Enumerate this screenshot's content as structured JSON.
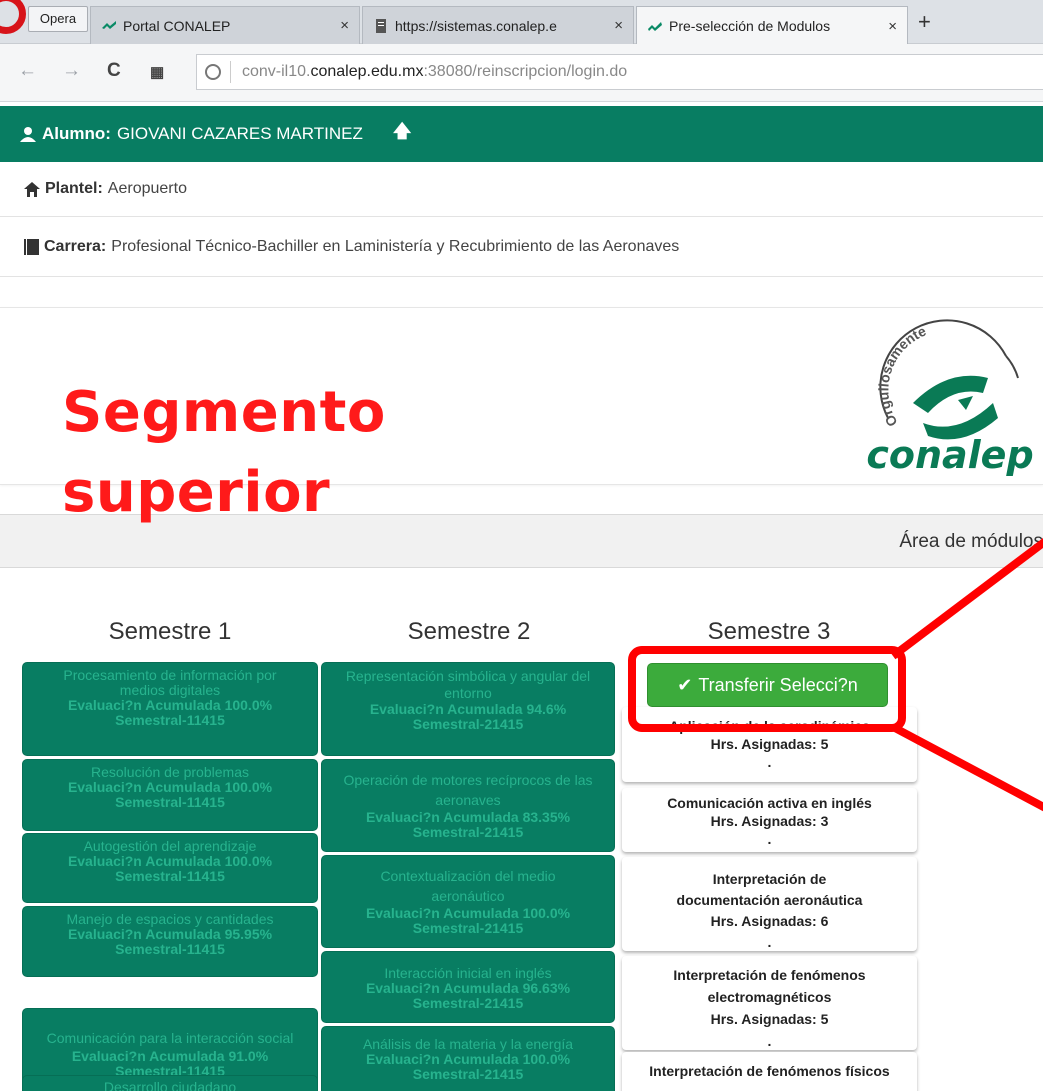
{
  "browser": {
    "menu_label": "Opera",
    "tabs": [
      {
        "title": "Portal CONALEP",
        "close": "×"
      },
      {
        "title": "https://sistemas.conalep.e",
        "close": "×"
      },
      {
        "title": "Pre-selección de Modulos",
        "close": "×"
      }
    ],
    "new_tab": "+",
    "url_prefix": "conv-il10.",
    "url_domain": "conalep.edu.mx",
    "url_suffix": ":38080/reinscripcion/login.do"
  },
  "student": {
    "label": "Alumno:",
    "name": "GIOVANI CAZARES MARTINEZ",
    "arrow": "🡅"
  },
  "plantel": {
    "label": "Plantel:",
    "value": "Aeropuerto"
  },
  "carrera": {
    "label": "Carrera:",
    "value": "Profesional Técnico-Bachiller en Laministería y Recubrimiento de las Aeronaves"
  },
  "annotation": {
    "line1": "Segmento",
    "line2": "superior"
  },
  "logo": {
    "arc_text": "Orgullosamente",
    "brand": "conalep"
  },
  "area_title": "Área de módulos",
  "semesters": [
    {
      "title": "Semestre 1"
    },
    {
      "title": "Semestre 2"
    },
    {
      "title": "Semestre 3"
    }
  ],
  "semester1_modules": [
    {
      "name": "Procesamiento de información por medios digitales",
      "eval": "Evaluaci?n Acumulada 100.0%",
      "sem": "Semestral-11415"
    },
    {
      "name": "Resolución de problemas",
      "eval": "Evaluaci?n Acumulada 100.0%",
      "sem": "Semestral-11415"
    },
    {
      "name": "Autogestión del aprendizaje",
      "eval": "Evaluaci?n Acumulada 100.0%",
      "sem": "Semestral-11415"
    },
    {
      "name": "Manejo de espacios y cantidades",
      "eval": "Evaluaci?n Acumulada 95.95%",
      "sem": "Semestral-11415"
    },
    {
      "name": "Comunicación para la interacción social",
      "eval": "Evaluaci?n Acumulada 91.0%",
      "sem": "Semestral-11415"
    },
    {
      "name": "Desarrollo ciudadano",
      "eval": "",
      "sem": ""
    }
  ],
  "semester2_modules": [
    {
      "name": "Representación simbólica y angular del entorno",
      "eval": "Evaluaci?n Acumulada 94.6%",
      "sem": "Semestral-21415"
    },
    {
      "name": "Operación de motores recíprocos de las aeronaves",
      "eval": "Evaluaci?n Acumulada 83.35%",
      "sem": "Semestral-21415"
    },
    {
      "name": "Contextualización del medio aeronáutico",
      "eval": "Evaluaci?n Acumulada 100.0%",
      "sem": "Semestral-21415"
    },
    {
      "name": "Interacción inicial en inglés",
      "eval": "Evaluaci?n Acumulada 96.63%",
      "sem": "Semestral-21415"
    },
    {
      "name": "Análisis de la materia y la energía",
      "eval": "Evaluaci?n Acumulada 100.0%",
      "sem": "Semestral-21415"
    }
  ],
  "transfer_button": {
    "icon": "✔",
    "label": "Transferir Selecci?n"
  },
  "semester3_modules": [
    {
      "name": "Aplicación de la aerodinámica",
      "hours": "Hrs. Asignadas: 5",
      "dot": "."
    },
    {
      "name": "Comunicación activa en inglés",
      "hours": "Hrs. Asignadas: 3",
      "dot": "."
    },
    {
      "name": "Interpretación de documentación aeronáutica",
      "hours": "Hrs. Asignadas: 6",
      "dot": "."
    },
    {
      "name": "Interpretación de fenómenos electromagnéticos",
      "hours": "Hrs. Asignadas: 5",
      "dot": "."
    },
    {
      "name": "Interpretación de fenómenos físicos de la materia",
      "hours": "",
      "dot": ""
    }
  ],
  "colors": {
    "header_green": "#087d62",
    "button_green": "#3cab3c",
    "annotation_red": "#ff0000"
  }
}
